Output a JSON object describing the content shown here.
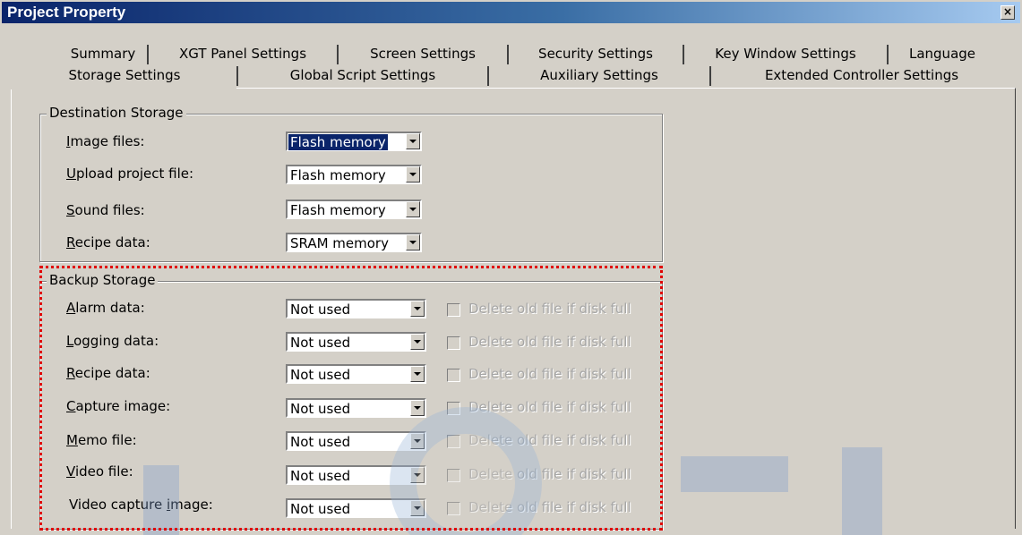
{
  "window": {
    "title": "Project Property",
    "close_label": "×"
  },
  "tabs": {
    "row1": [
      {
        "label": "Summary"
      },
      {
        "label": "XGT Panel Settings"
      },
      {
        "label": "Screen Settings"
      },
      {
        "label": "Security Settings"
      },
      {
        "label": "Key Window Settings"
      },
      {
        "label": "Language"
      }
    ],
    "row2": [
      {
        "label": "Storage Settings",
        "active": true
      },
      {
        "label": "Global Script Settings"
      },
      {
        "label": "Auxiliary Settings"
      },
      {
        "label": "Extended Controller Settings"
      }
    ]
  },
  "destination": {
    "title": "Destination Storage",
    "rows": [
      {
        "label_u": "I",
        "label_rest": "mage files:",
        "value": "Flash memory",
        "selected": true
      },
      {
        "label_u": "U",
        "label_rest": "pload project file:",
        "value": "Flash memory"
      },
      {
        "label_u": "S",
        "label_rest": "ound files:",
        "value": "Flash memory"
      },
      {
        "label_u": "R",
        "label_rest": "ecipe data:",
        "value": "SRAM memory"
      }
    ]
  },
  "backup": {
    "title": "Backup Storage",
    "checkbox_label": "Delete old file if disk full",
    "rows": [
      {
        "label_u": "A",
        "label_rest": "larm data:",
        "value": "Not used"
      },
      {
        "label_u": "L",
        "label_rest": "ogging data:",
        "value": "Not used"
      },
      {
        "label_u": "R",
        "label_rest": "ecipe data:",
        "value": "Not used"
      },
      {
        "label_u": "C",
        "label_rest": "apture image:",
        "value": "Not used"
      },
      {
        "label_u": "M",
        "label_rest": "emo file:",
        "value": "Not used"
      },
      {
        "label_u": "V",
        "label_rest": "ideo file:",
        "value": "Not used"
      },
      {
        "label_pre": "Video capture ",
        "label_u": "i",
        "label_rest": "mage:",
        "value": "Not used"
      }
    ]
  },
  "colors": {
    "highlight": "#e00000",
    "title_bar": "#0a246a",
    "dialog_bg": "#d4d0c8"
  }
}
